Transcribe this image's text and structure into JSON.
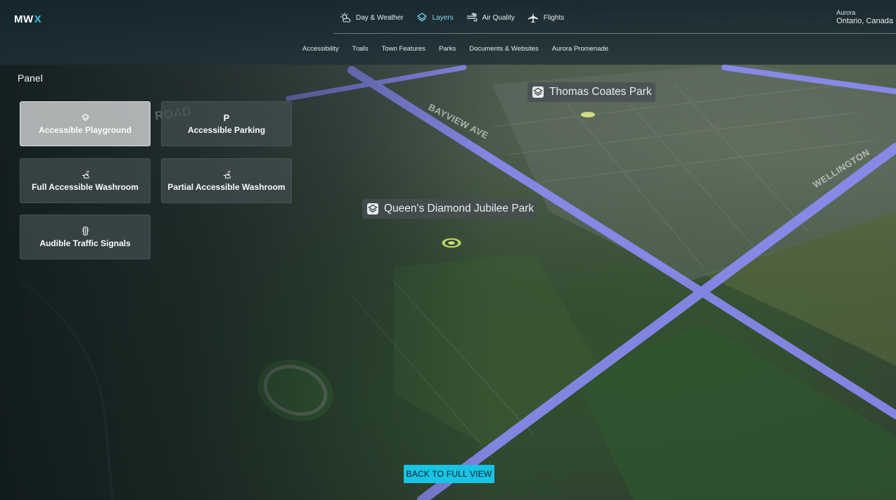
{
  "app": {
    "logo_prefix": "MW",
    "logo_accent": "X",
    "accent_color": "#18c3e3"
  },
  "main_nav": [
    {
      "label": "Day & Weather",
      "icon": "sun-cloud-icon",
      "active": false
    },
    {
      "label": "Layers",
      "icon": "layers-icon",
      "active": true
    },
    {
      "label": "Air Quality",
      "icon": "wind-icon",
      "active": false
    },
    {
      "label": "Flights",
      "icon": "plane-icon",
      "active": false
    }
  ],
  "location": {
    "city": "Aurora",
    "region": "Ontario, Canada"
  },
  "sub_nav": [
    "Accessibility",
    "Trails",
    "Town Features",
    "Parks",
    "Documents & Websites",
    "Aurora Promenade"
  ],
  "panel": {
    "title": "Panel",
    "tiles": [
      {
        "label": "Accessible Playground",
        "icon": "layers-icon",
        "selected": true
      },
      {
        "label": "Accessible Parking",
        "icon": "parking-icon",
        "icon_text": "P",
        "selected": false
      },
      {
        "label": "Full Accessible Washroom",
        "icon": "hand-wash-icon",
        "selected": false
      },
      {
        "label": "Partial Accessible Washroom",
        "icon": "hand-wash-icon",
        "selected": false
      },
      {
        "label": "Audible Traffic Signals",
        "icon": "traffic-light-icon",
        "selected": false
      }
    ]
  },
  "map": {
    "parks": [
      "Thomas Coates Park",
      "Queen's Diamond Jubilee Park"
    ],
    "roads": [
      "BAYVIEW AVE",
      "WELLINGTON",
      "ROAD"
    ],
    "road_highlight_color": "#8f8fff"
  },
  "back_button": {
    "label": "BACK TO FULL VIEW"
  }
}
